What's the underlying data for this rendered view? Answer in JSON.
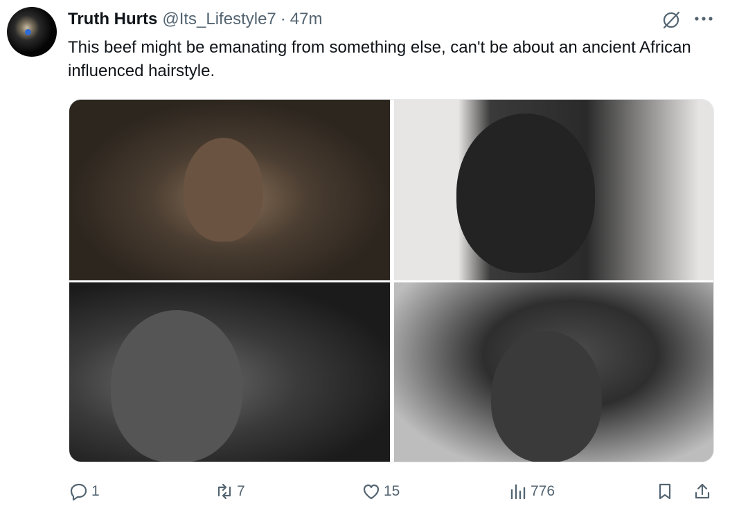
{
  "tweet": {
    "display_name": "Truth Hurts",
    "handle": "@Its_Lifestyle7",
    "separator": "·",
    "time": "47m",
    "text": "This beef might be emanating from something else, can't be about an ancient African influenced hairstyle."
  },
  "actions": {
    "replies": "1",
    "retweets": "7",
    "likes": "15",
    "views": "776"
  },
  "colors": {
    "text_primary": "#0f1419",
    "text_secondary": "#536471"
  },
  "icons": [
    "avatar",
    "grok-icon",
    "more-icon",
    "reply-icon",
    "retweet-icon",
    "like-icon",
    "views-icon",
    "bookmark-icon",
    "share-icon"
  ]
}
